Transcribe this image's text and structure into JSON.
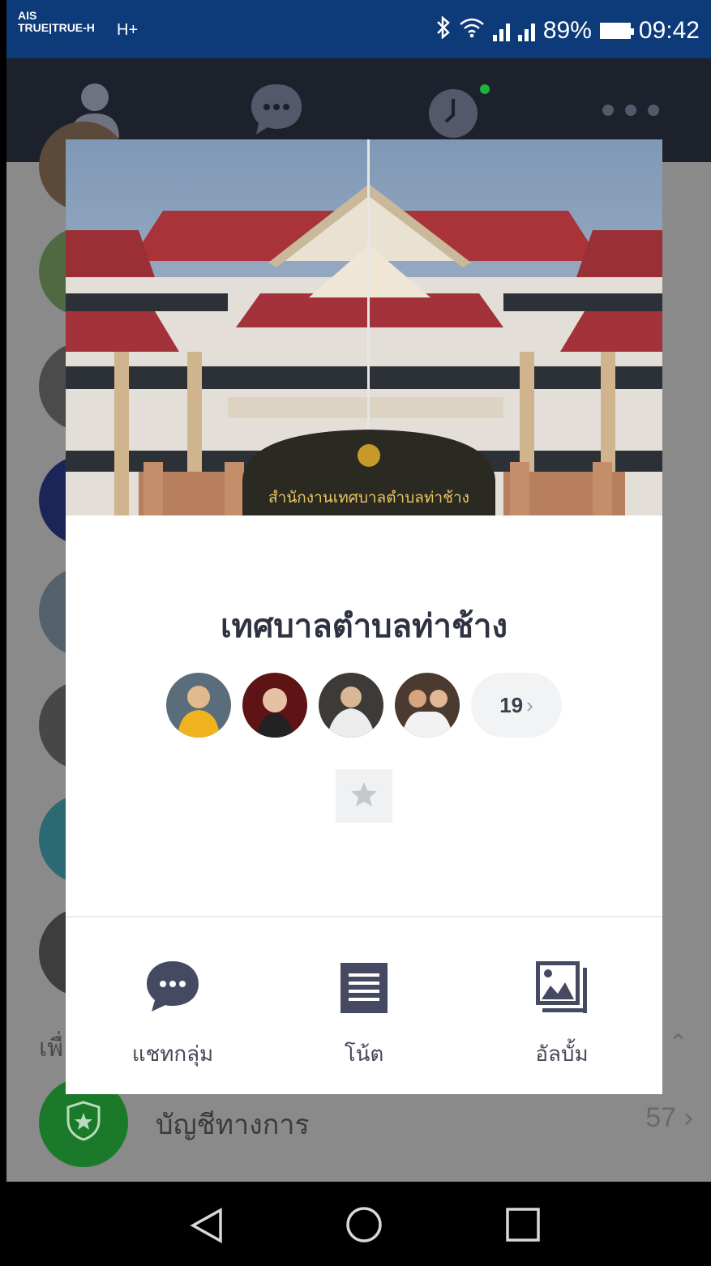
{
  "status_bar": {
    "carrier_line1": "AIS",
    "carrier_line2": "TRUE|TRUE-H",
    "network": "H+",
    "battery": "89%",
    "time": "09:42"
  },
  "top_nav": {
    "items": [
      {
        "icon": "person-icon"
      },
      {
        "icon": "chat-bubble-icon"
      },
      {
        "icon": "timeline-clock-icon"
      },
      {
        "icon": "more-dots-icon"
      }
    ]
  },
  "background_list": {
    "section_label": "เพื่",
    "official_label": "บัญชีทางการ",
    "official_count": "57",
    "official_chevron": "›"
  },
  "modal": {
    "cover_sign_text": "สำนักงานเทศบาลตำบลท่าช้าง",
    "group_name": "เทศบาลตำบลท่าช้าง",
    "member_count": "19",
    "member_count_chevron": "›",
    "actions": [
      {
        "label": "แชทกลุ่ม",
        "icon": "group-chat-icon"
      },
      {
        "label": "โน้ต",
        "icon": "note-icon"
      },
      {
        "label": "อัลบั้ม",
        "icon": "album-icon"
      }
    ]
  },
  "colors": {
    "status_bar": "#0d3a78",
    "app_nav": "#1d212b",
    "icon_dark": "#454a62",
    "official_green": "#1a7a2a"
  }
}
